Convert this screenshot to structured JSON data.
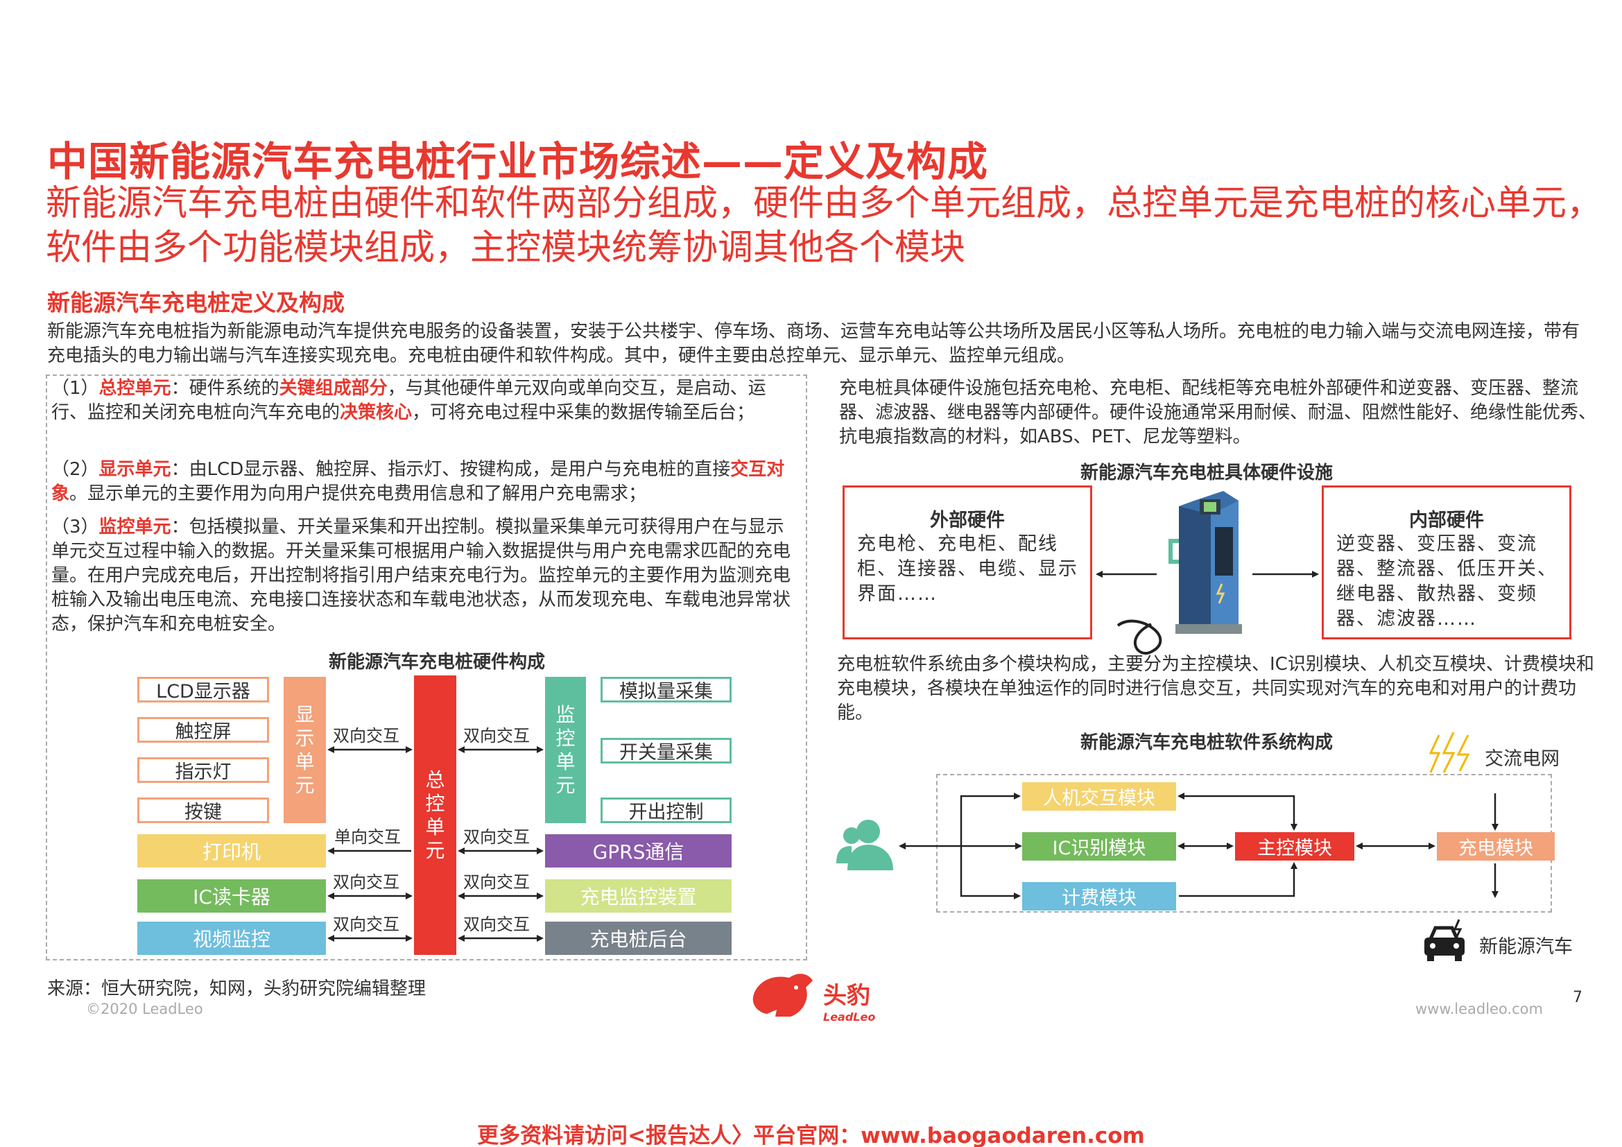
{
  "header": {
    "title": "中国新能源汽车充电桩行业市场综述——定义及构成",
    "subtitle": "新能源汽车充电桩由硬件和软件两部分组成，硬件由多个单元组成，总控单元是充电桩的核心单元，软件由多个功能模块组成，主控模块统筹协调其他各个模块"
  },
  "section_title": "新能源汽车充电桩定义及构成",
  "intro": "新能源汽车充电桩指为新能源电动汽车提供充电服务的设备装置，安装于公共楼宇、停车场、商场、运营车充电站等公共场所及居民小区等私人场所。充电桩的电力输入端与交流电网连接，带有充电插头的电力输出端与汽车连接实现充电。充电桩由硬件和软件构成。其中，硬件主要由总控单元、显示单元、监控单元组成。",
  "left_panel": {
    "p1": {
      "prefix": "（1）",
      "term": "总控单元",
      "t1": "：硬件系统的",
      "key1": "关键组成部分",
      "t2": "，与其他硬件单元双向或单向交互，是启动、运行、监控和关闭充电桩向汽车充电的",
      "key2": "决策核心",
      "t3": "，可将充电过程中采集的数据传输至后台；"
    },
    "p2": {
      "prefix": "（2）",
      "term": "显示单元",
      "t1": "：由LCD显示器、触控屏、指示灯、按键构成，是用户与充电桩的直接",
      "key1": "交互对象",
      "t2": "。显示单元的主要作用为向用户提供充电费用信息和了解用户充电需求；"
    },
    "p3": {
      "prefix": "（3）",
      "term": "监控单元",
      "t1": "：包括模拟量、开关量采集和开出控制。模拟量采集单元可获得用户在与显示单元交互过程中输入的数据。开关量采集可根据用户输入数据提供与用户充电需求匹配的充电量。在用户完成充电后，开出控制将指引用户结束充电行为。监控单元的主要作用为监测充电桩输入及输出电压电流、充电接口连接状态和车载电池状态，从而发现充电、车载电池异常状态，保护汽车和充电桩安全。"
    },
    "diagram_title": "新能源汽车充电桩硬件构成",
    "display_items": [
      "LCD显示器",
      "触控屏",
      "指示灯",
      "按键"
    ],
    "display_unit": "显示单元",
    "control_unit": "总控单元",
    "monitor_unit": "监控单元",
    "monitor_items": [
      "模拟量采集",
      "开关量采集",
      "开出控制"
    ],
    "left_bars": [
      "打印机",
      "IC读卡器",
      "视频监控"
    ],
    "right_bars": [
      "GPRS通信",
      "充电监控装置",
      "充电桩后台"
    ],
    "arrow_labels": {
      "disp": "双向交互",
      "mon": "双向交互",
      "printer": "单向交互",
      "gprs": "双向交互",
      "ic": "双向交互",
      "monitor_dev": "双向交互",
      "video": "双向交互",
      "backend": "双向交互"
    },
    "colors": {
      "orange": "#f3a27a",
      "red": "#e8382f",
      "green": "#5dbf9e",
      "yellow": "#f5d36e",
      "green2": "#74bb5d",
      "blue": "#6dbfdd",
      "purple": "#8a5aab",
      "lightgreen": "#d2e48a",
      "gray": "#78828b"
    }
  },
  "right_panel": {
    "hw_text": "充电桩具体硬件设施包括充电枪、充电柜、配线柜等充电桩外部硬件和逆变器、变压器、整流器、滤波器、继电器等内部硬件。硬件设施通常采用耐候、耐温、阻燃性能好、绝缘性能优秀、抗电痕指数高的材料，如ABS、PET、尼龙等塑料。",
    "hw_title": "新能源汽车充电桩具体硬件设施",
    "external": {
      "title": "外部硬件",
      "body": "充电枪、充电柜、配线柜、连接器、电缆、显示界面……"
    },
    "internal": {
      "title": "内部硬件",
      "body": "逆变器、变压器、变流器、整流器、低压开关、继电器、散热器、变频器、滤波器……"
    },
    "sw_text": "充电桩软件系统由多个模块构成，主要分为主控模块、IC识别模块、人机交互模块、计费模块和充电模块，各模块在单独运作的同时进行信息交互，共同实现对汽车的充电和对用户的计费功能。",
    "sw_title": "新能源汽车充电桩软件系统构成",
    "grid_label": "交流电网",
    "car_label": "新能源汽车",
    "modules": {
      "hmi": "人机交互模块",
      "ic": "IC识别模块",
      "billing": "计费模块",
      "main": "主控模块",
      "charge": "充电模块"
    },
    "icons": [
      "user-icon",
      "lightning-icon",
      "car-icon",
      "charging-pile-icon"
    ]
  },
  "footer": {
    "source": "来源：恒大研究院，知网，头豹研究院编辑整理",
    "copyright": "©2020 LeadLeo",
    "logo_cn": "头豹",
    "logo_en": "LeadLeo",
    "website": "www.leadleo.com",
    "page": "7",
    "promo": "更多资料请访问<报告达人〉平台官网：www.baogaodaren.com"
  }
}
